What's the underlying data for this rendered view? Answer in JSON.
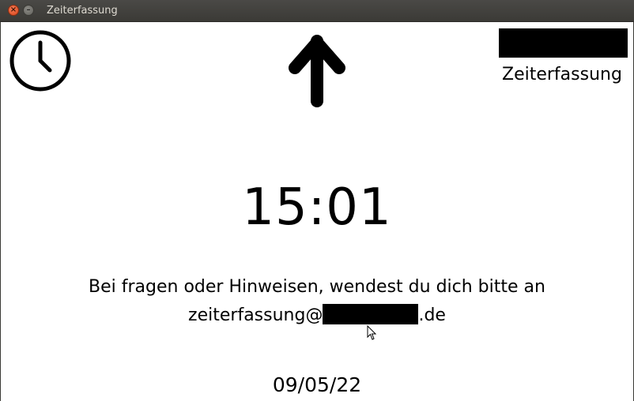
{
  "window": {
    "title": "Zeiterfassung",
    "close_glyph": "×",
    "minimize_glyph": "–"
  },
  "header": {
    "app_label": "Zeiterfassung",
    "left_icon": "clock-icon",
    "center_icon": "arrow-up-icon",
    "logo": "redacted-logo"
  },
  "main": {
    "time": "15:01",
    "message_line1": "Bei fragen oder Hinweisen, wendest du dich bitte an",
    "email_prefix": "zeiterfassung@",
    "email_suffix": ".de",
    "date": "09/05/22"
  },
  "colors": {
    "background": "#ffffff",
    "text": "#000000",
    "titlebar": "#3c3b37",
    "close_button": "#e5531f"
  }
}
